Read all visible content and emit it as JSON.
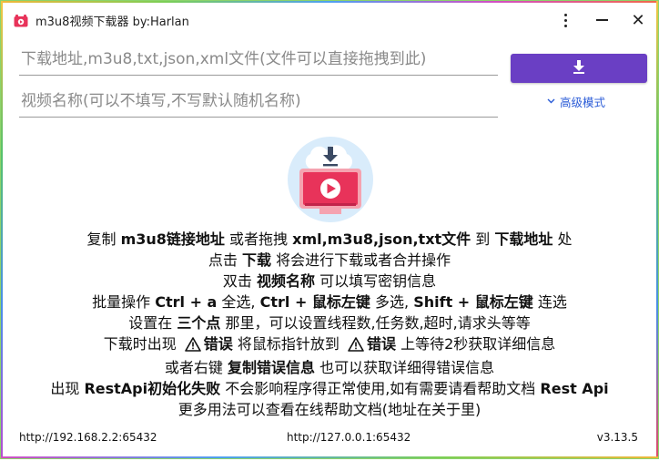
{
  "window": {
    "title": "m3u8视频下载器 by:Harlan",
    "menu_icon": "vertical-dots-icon",
    "minimize_icon": "minimize-icon",
    "close_icon": "close-icon",
    "close_glyph": "✕"
  },
  "form": {
    "url_placeholder": "下载地址,m3u8,txt,json,xml文件(文件可以直接拖拽到此)",
    "url_value": "",
    "name_placeholder": "视频名称(可以不填写,不写默认随机名称)",
    "name_value": "",
    "download_icon": "download-icon",
    "advanced_label": "高级模式",
    "advanced_icon": "chevron-down-icon"
  },
  "help": {
    "line1": {
      "a": "复制 ",
      "b": "m3u8链接地址",
      "c": " 或者拖拽 ",
      "d": "xml,m3u8,json,txt文件",
      "e": " 到 ",
      "f": "下载地址",
      "g": " 处"
    },
    "line2": {
      "a": "点击 ",
      "b": "下载",
      "c": " 将会进行下载或者合并操作"
    },
    "line3": {
      "a": "双击 ",
      "b": "视频名称",
      "c": " 可以填写密钥信息"
    },
    "line4": {
      "a": "批量操作 ",
      "b": "Ctrl + a",
      "c": " 全选, ",
      "d": "Ctrl + 鼠标左键",
      "e": " 多选, ",
      "f": "Shift + 鼠标左键",
      "g": " 连选"
    },
    "line5": {
      "a": "设置在 ",
      "b": "三个点",
      "c": " 那里，可以设置线程数,任务数,超时,请求头等等"
    },
    "line6": {
      "a": "下载时出现 ",
      "b": "错误",
      "c": " 将鼠标指针放到 ",
      "d": "错误",
      "e": " 上等待2秒获取详细信息"
    },
    "line7": {
      "a": "或者右键 ",
      "b": "复制错误信息",
      "c": " 也可以获取详细得错误信息"
    },
    "line8": {
      "a": "出现 ",
      "b": "RestApi初始化失败",
      "c": " 不会影响程序得正常使用,如有需要请看帮助文档 ",
      "d": "Rest Api"
    },
    "line9": {
      "a": "更多用法可以查看在线帮助文档(地址在关于里)"
    }
  },
  "status": {
    "left": "http://192.168.2.2:65432",
    "mid": "http://127.0.0.1:65432",
    "version": "v3.13.5"
  },
  "colors": {
    "accent": "#6a3fc4",
    "link": "#2a5bd7"
  }
}
